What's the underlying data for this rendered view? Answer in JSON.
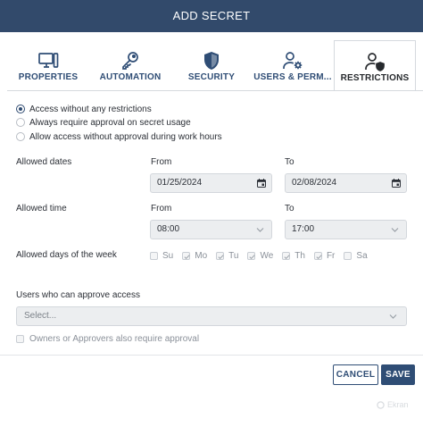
{
  "dialog": {
    "title": "ADD SECRET"
  },
  "tabs": [
    {
      "label": "PROPERTIES",
      "icon": "monitor-icon"
    },
    {
      "label": "AUTOMATION",
      "icon": "key-icon"
    },
    {
      "label": "SECURITY",
      "icon": "shield-icon"
    },
    {
      "label": "USERS & PERM...",
      "icon": "user-settings-icon"
    },
    {
      "label": "RESTRICTIONS",
      "icon": "user-shield-icon",
      "active": true
    }
  ],
  "access": {
    "options": [
      {
        "label": "Access without any restrictions",
        "selected": true
      },
      {
        "label": "Always require approval on secret usage",
        "selected": false
      },
      {
        "label": "Allow access without approval during work hours",
        "selected": false
      }
    ]
  },
  "allowed_dates": {
    "label": "Allowed dates",
    "from_label": "From",
    "to_label": "To",
    "from_value": "01/25/2024",
    "to_value": "02/08/2024"
  },
  "allowed_time": {
    "label": "Allowed time",
    "from_label": "From",
    "to_label": "To",
    "from_value": "08:00",
    "to_value": "17:00"
  },
  "allowed_days": {
    "label": "Allowed days of the week",
    "days": [
      {
        "label": "Su",
        "checked": false
      },
      {
        "label": "Mo",
        "checked": true
      },
      {
        "label": "Tu",
        "checked": true
      },
      {
        "label": "We",
        "checked": true
      },
      {
        "label": "Th",
        "checked": true
      },
      {
        "label": "Fr",
        "checked": true
      },
      {
        "label": "Sa",
        "checked": false
      }
    ]
  },
  "approvers": {
    "label": "Users who can approve access",
    "placeholder": "Select...",
    "owners_checkbox": "Owners or Approvers also require approval"
  },
  "buttons": {
    "cancel": "CANCEL",
    "save": "SAVE"
  },
  "watermark": "Ekran",
  "colors": {
    "header": "#324a6b",
    "accent": "#2f4d75"
  }
}
